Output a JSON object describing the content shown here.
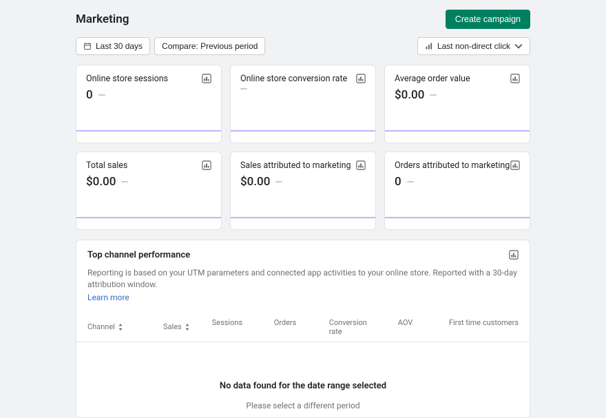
{
  "header": {
    "title": "Marketing",
    "create_campaign": "Create campaign"
  },
  "controls": {
    "date_range": "Last 30 days",
    "compare": "Compare: Previous period",
    "attribution": "Last non-direct click"
  },
  "cards": [
    {
      "title": "Online store sessions",
      "value": "0",
      "has_value": true
    },
    {
      "title": "Online store conversion rate",
      "value": "",
      "has_value": false
    },
    {
      "title": "Average order value",
      "value": "$0.00",
      "has_value": true
    },
    {
      "title": "Total sales",
      "value": "$0.00",
      "has_value": true
    },
    {
      "title": "Sales attributed to marketing",
      "value": "$0.00",
      "has_value": true
    },
    {
      "title": "Orders attributed to marketing",
      "value": "0",
      "has_value": true
    }
  ],
  "channel_panel": {
    "title": "Top channel performance",
    "description": "Reporting is based on your UTM parameters and connected app activities to your online store. Reported with a 30-day attribution window.",
    "learn_more": "Learn more",
    "columns": {
      "channel": "Channel",
      "sales": "Sales",
      "sessions": "Sessions",
      "orders": "Orders",
      "conversion": "Conversion rate",
      "aov": "AOV",
      "first_time": "First time customers"
    },
    "empty": {
      "title": "No data found for the date range selected",
      "subtitle": "Please select a different period"
    }
  }
}
